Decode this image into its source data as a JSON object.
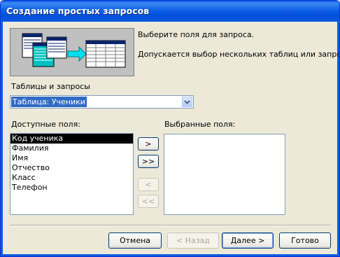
{
  "window": {
    "title": "Создание простых запросов"
  },
  "intro": {
    "line1": "Выберите поля для запроса.",
    "line2": "Допускается выбор нескольких таблиц или запросов."
  },
  "source": {
    "label": "Таблицы и запросы",
    "selected": "Таблица: Ученики"
  },
  "available": {
    "label": "Доступные поля:",
    "items": [
      "Код ученика",
      "Фамилия",
      "Имя",
      "Отчество",
      "Класс",
      "Телефон"
    ],
    "selected_index": 0
  },
  "selected": {
    "label": "Выбранные поля:",
    "items": []
  },
  "move_buttons": {
    "add_one": ">",
    "add_all": ">>",
    "remove_one": "<",
    "remove_all": "<<"
  },
  "footer": {
    "cancel": "Отмена",
    "back": "< Назад",
    "next": "Далее >",
    "finish": "Готово"
  },
  "icons": {
    "banner": "wizard-illustration-icon",
    "dropdown": "chevron-down-icon"
  }
}
